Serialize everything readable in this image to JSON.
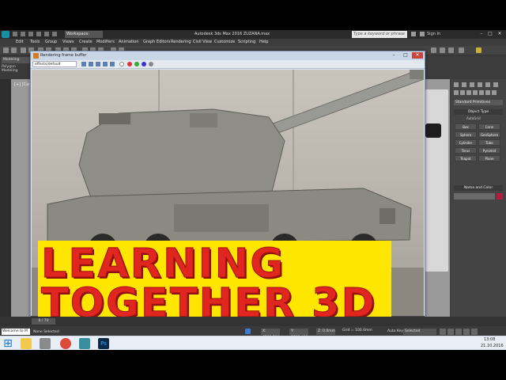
{
  "titlebar": {
    "workspace": "Workspace: Default",
    "title": "Autodesk 3ds Max 2016   ZUZANA.max",
    "search_placeholder": "Type a keyword or phrase",
    "signin": "Sign In",
    "minimize": "–",
    "maximize": "□",
    "close": "✕"
  },
  "menu": [
    "Edit",
    "Tools",
    "Group",
    "Views",
    "Create",
    "Modifiers",
    "Animation",
    "Graph Editors",
    "Rendering",
    "Civil View",
    "Customize",
    "Scripting",
    "Help"
  ],
  "ribbon": {
    "tab": "Modeling",
    "sub": "Polygon Modeling"
  },
  "viewport": {
    "label": "[+] [Came"
  },
  "frame_buffer": {
    "title": "Rendering frame buffer",
    "viewport_select": "effects/default",
    "status": "Rendering Time 0:00:59  Translation Time 0:00:02  Elapsed 0:01:04  Render Time 0:00:59"
  },
  "banner": {
    "line1": "LEARNING",
    "line2": "TOGETHER 3D"
  },
  "command_panel": {
    "dropdown": "Standard Primitives",
    "object_type": "Object Type",
    "autogrid": "AutoGrid",
    "primitives": [
      "Box",
      "Cone",
      "Sphere",
      "GeoSphere",
      "Cylinder",
      "Tube",
      "Torus",
      "Pyramid",
      "Teapot",
      "Plane"
    ],
    "name_color": "Name and Color",
    "color": "#b01c44"
  },
  "timeline": {
    "frame": "0 / 70"
  },
  "status": {
    "script": "Welcome to M",
    "line1": "None Selected",
    "line2": "Rendering Time  0:00:59",
    "x": "X: 6588.709",
    "y": "Y: 5788.409",
    "z": "Z: 0.0mm",
    "grid": "Grid = 100.0mm",
    "add_time_tag": "Add Time Tag",
    "auto_key": "Auto Key",
    "set_key": "Set Key",
    "selected": "Selected",
    "key_filters": "Key Filters..."
  },
  "taskbar": {
    "start": "⊞",
    "time": "13:08",
    "date": "21.10.2016"
  }
}
